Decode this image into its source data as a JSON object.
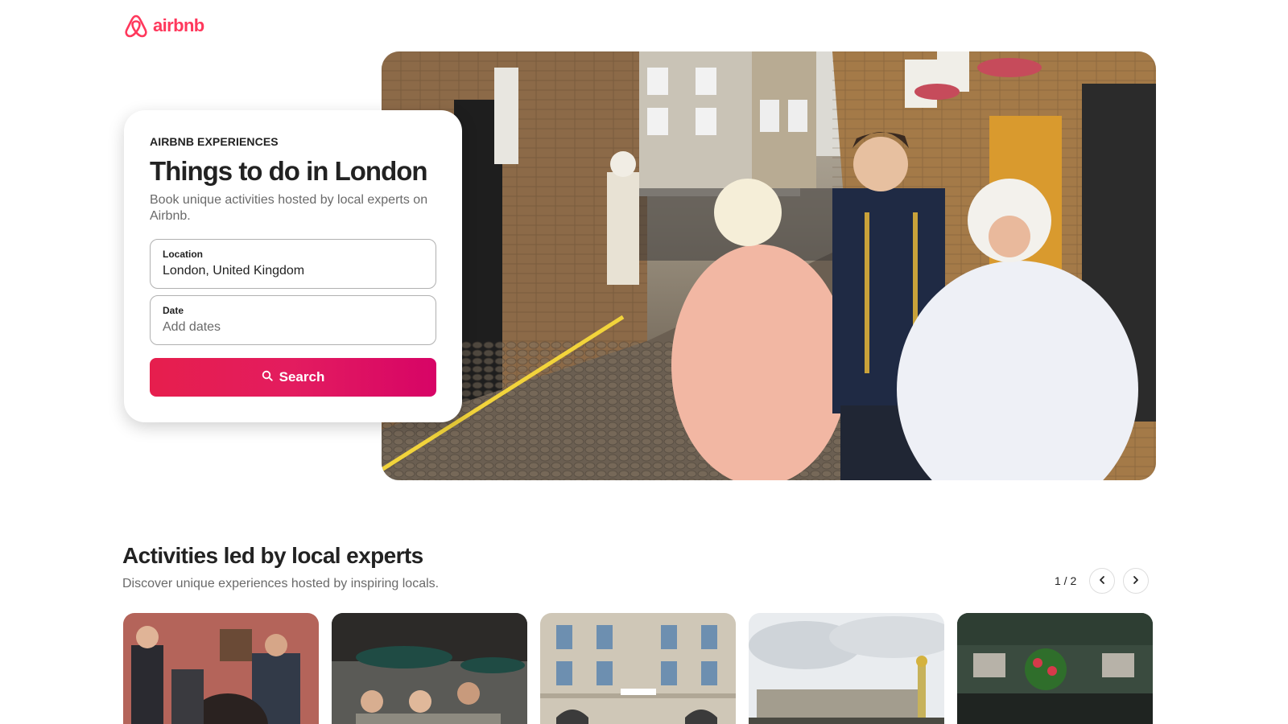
{
  "brand": {
    "name": "airbnb",
    "logo_icon": "airbnb-belo-icon",
    "color": "#ff385c"
  },
  "hero": {
    "eyebrow": "AIRBNB EXPERIENCES",
    "title": "Things to do in London",
    "subtitle": "Book unique activities hosted by local experts on Airbnb.",
    "location": {
      "label": "Location",
      "value": "London, United Kingdom"
    },
    "date": {
      "label": "Date",
      "placeholder": "Add dates"
    },
    "search_button": {
      "label": "Search",
      "icon": "search-icon"
    },
    "accent_gradient": [
      "#e61e4d",
      "#e31c5f",
      "#d70466"
    ]
  },
  "activities": {
    "title": "Activities led by local experts",
    "subtitle": "Discover unique experiences hosted by inspiring locals.",
    "pager": {
      "text": "1 / 2",
      "prev_icon": "chevron-left-icon",
      "next_icon": "chevron-right-icon"
    },
    "cards": [
      {
        "image": "gallery-group-photo"
      },
      {
        "image": "street-cafe-group-photo"
      },
      {
        "image": "hsbc-building-photo"
      },
      {
        "image": "buckingham-palace-photo"
      },
      {
        "image": "gladstone-pub-photo"
      }
    ]
  }
}
